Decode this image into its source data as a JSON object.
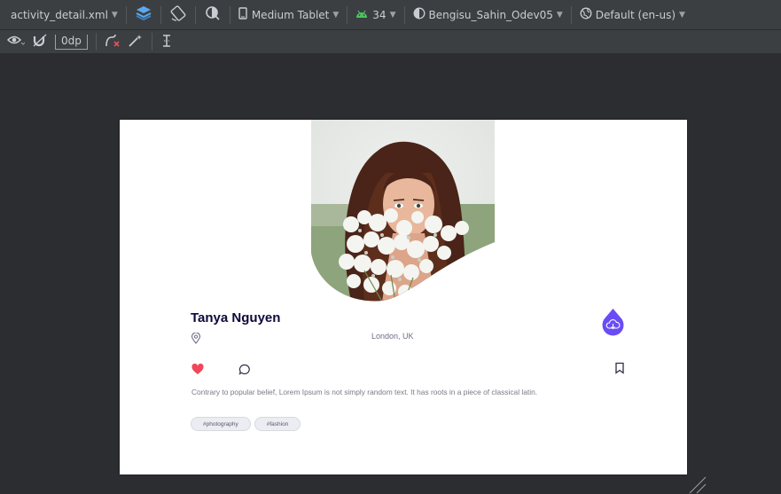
{
  "toolbar": {
    "file_name": "activity_detail.xml",
    "device": "Medium Tablet",
    "api_level": "34",
    "theme": "Bengisu_Sahin_Odev05",
    "locale": "Default (en-us)",
    "margin_value": "0dp"
  },
  "profile": {
    "name": "Tanya Nguyen",
    "location": "London, UK",
    "description": "Contrary to popular belief, Lorem Ipsum is not simply random text. It has roots in a piece of classical latin.",
    "tags": [
      "#photography",
      "#fashion"
    ]
  },
  "colors": {
    "accent": "#6a4cf5",
    "heart": "#f0475b",
    "name": "#0d0a3a",
    "ide_bg": "#2b2d30",
    "toolbar_bg": "#3c3f41"
  },
  "icons": {
    "toolbar1": [
      "design-surface-icon",
      "orientation-icon",
      "night-mode-icon",
      "device-icon",
      "android-icon",
      "theme-icon",
      "locale-globe-icon"
    ],
    "toolbar2": [
      "view-options-eye-icon",
      "autoconnect-magnet-icon",
      "clear-constraints-icon",
      "infer-constraints-wand-icon",
      "guidelines-icon"
    ],
    "content": [
      "location-pin-icon",
      "cloud-download-icon",
      "heart-icon",
      "comment-icon",
      "bookmark-icon"
    ]
  }
}
